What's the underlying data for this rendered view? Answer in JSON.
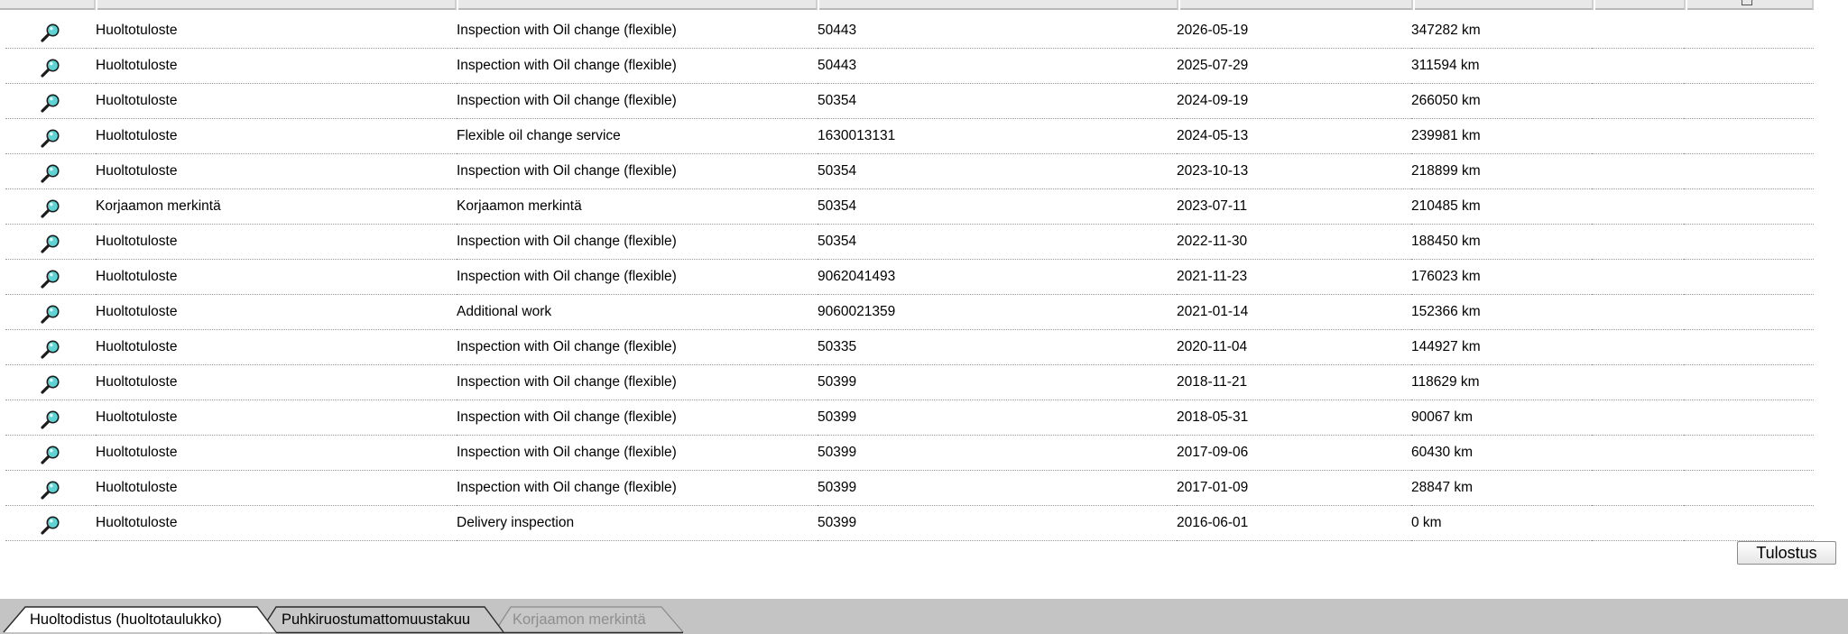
{
  "table": {
    "rows": [
      {
        "type": "Huoltotuloste",
        "description": "Inspection with Oil change (flexible)",
        "code": "50443",
        "date": "2026-05-19",
        "mileage": "347282 km"
      },
      {
        "type": "Huoltotuloste",
        "description": "Inspection with Oil change (flexible)",
        "code": "50443",
        "date": "2025-07-29",
        "mileage": "311594 km"
      },
      {
        "type": "Huoltotuloste",
        "description": "Inspection with Oil change (flexible)",
        "code": "50354",
        "date": "2024-09-19",
        "mileage": "266050 km"
      },
      {
        "type": "Huoltotuloste",
        "description": "Flexible oil change service",
        "code": "1630013131",
        "date": "2024-05-13",
        "mileage": "239981 km"
      },
      {
        "type": "Huoltotuloste",
        "description": "Inspection with Oil change (flexible)",
        "code": "50354",
        "date": "2023-10-13",
        "mileage": "218899 km"
      },
      {
        "type": "Korjaamon merkintä",
        "description": "Korjaamon merkintä",
        "code": "50354",
        "date": "2023-07-11",
        "mileage": "210485 km"
      },
      {
        "type": "Huoltotuloste",
        "description": "Inspection with Oil change (flexible)",
        "code": "50354",
        "date": "2022-11-30",
        "mileage": "188450 km"
      },
      {
        "type": "Huoltotuloste",
        "description": "Inspection with Oil change (flexible)",
        "code": "9062041493",
        "date": "2021-11-23",
        "mileage": "176023 km"
      },
      {
        "type": "Huoltotuloste",
        "description": "Additional work",
        "code": "9060021359",
        "date": "2021-01-14",
        "mileage": "152366 km"
      },
      {
        "type": "Huoltotuloste",
        "description": "Inspection with Oil change (flexible)",
        "code": "50335",
        "date": "2020-11-04",
        "mileage": "144927 km"
      },
      {
        "type": "Huoltotuloste",
        "description": "Inspection with Oil change (flexible)",
        "code": "50399",
        "date": "2018-11-21",
        "mileage": "118629 km"
      },
      {
        "type": "Huoltotuloste",
        "description": "Inspection with Oil change (flexible)",
        "code": "50399",
        "date": "2018-05-31",
        "mileage": "90067 km"
      },
      {
        "type": "Huoltotuloste",
        "description": "Inspection with Oil change (flexible)",
        "code": "50399",
        "date": "2017-09-06",
        "mileage": "60430 km"
      },
      {
        "type": "Huoltotuloste",
        "description": "Inspection with Oil change (flexible)",
        "code": "50399",
        "date": "2017-01-09",
        "mileage": "28847 km"
      },
      {
        "type": "Huoltotuloste",
        "description": "Delivery inspection",
        "code": "50399",
        "date": "2016-06-01",
        "mileage": "0 km"
      }
    ],
    "row_icon": "magnifier-icon"
  },
  "actions": {
    "print_label": "Tulostus"
  },
  "tabs": [
    {
      "label": "Huoltodistus (huoltotaulukko)",
      "state": "active"
    },
    {
      "label": "Puhkiruostumattomuustakuu",
      "state": "normal"
    },
    {
      "label": "Korjaamon merkintä",
      "state": "disabled"
    }
  ],
  "colors": {
    "icon_lens": "#5fd3d3",
    "tabbar_bg": "#c4c4c4",
    "disabled_tab_text": "#8e8e8e"
  }
}
